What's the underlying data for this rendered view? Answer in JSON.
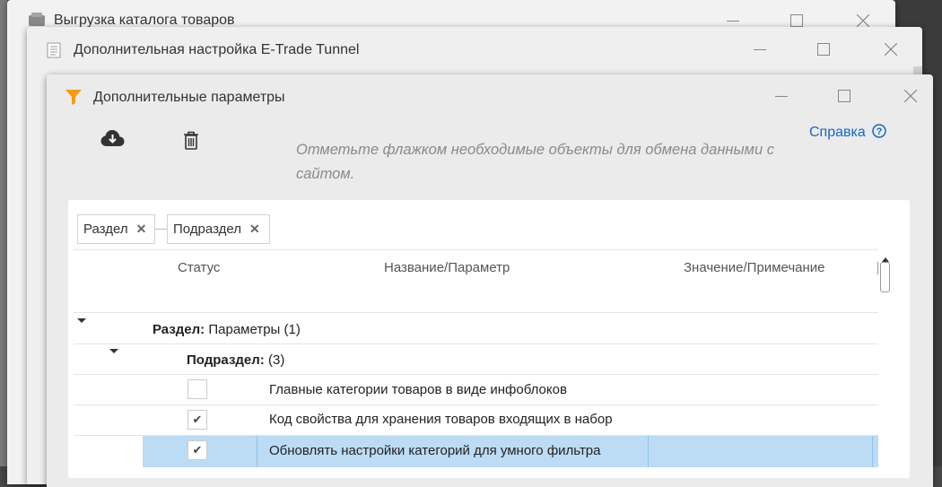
{
  "windows": {
    "back": {
      "title": "Выгрузка каталога товаров"
    },
    "middle": {
      "title": "Дополнительная настройка E-Trade Tunnel"
    },
    "front": {
      "title": "Дополнительные параметры"
    }
  },
  "toolbar": {
    "save_icon": "cloud-download-icon",
    "delete_icon": "trash-icon",
    "hint": "Отметьте флажком необходимые объекты для обмена данными с сайтом.",
    "help_label": "Справка"
  },
  "grouping": {
    "chips": [
      "Раздел",
      "Подраздел"
    ]
  },
  "table": {
    "columns": [
      "Статус",
      "Название/Параметр",
      "Значение/Примечание"
    ],
    "section": {
      "label": "Раздел:",
      "value": "Параметры (1)"
    },
    "subsection": {
      "label": "Подраздел:",
      "value": "(3)"
    },
    "rows": [
      {
        "checked": "",
        "name": "Главные категории товаров в виде инфоблоков",
        "value": ""
      },
      {
        "checked": "✔",
        "name": "Код свойства для хранения товаров входящих в набор",
        "value": ""
      },
      {
        "checked": "✔",
        "name": "Обновлять настройки категорий для умного фильтра",
        "value": ""
      }
    ]
  },
  "colors": {
    "accent": "#1a66c8",
    "selected_row": "#bcdcf5",
    "filter_icon": "#f39c12"
  }
}
